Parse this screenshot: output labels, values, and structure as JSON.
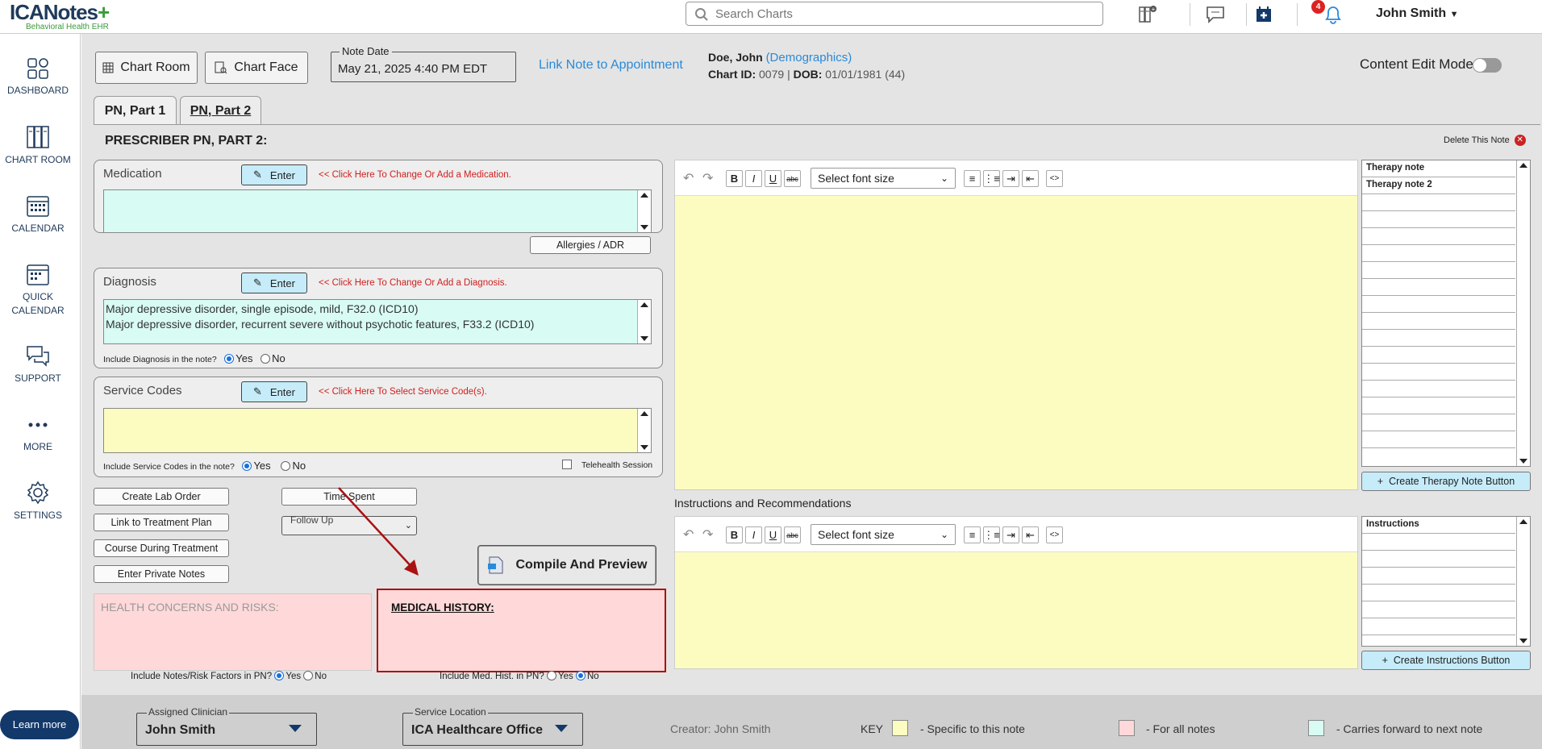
{
  "app": {
    "logo_main": "ICANotes",
    "logo_sub": "Behavioral Health EHR",
    "search_placeholder": "Search Charts",
    "notification_count": "4",
    "user_name": "John Smith"
  },
  "sidebar": {
    "items": [
      {
        "label": "DASHBOARD",
        "icon": "dashboard-icon"
      },
      {
        "label": "CHART ROOM",
        "icon": "chart-room-icon"
      },
      {
        "label": "CALENDAR",
        "icon": "calendar-icon"
      },
      {
        "label": "QUICK CALENDAR",
        "icon": "quick-calendar-icon"
      },
      {
        "label": "SUPPORT",
        "icon": "support-icon"
      },
      {
        "label": "MORE",
        "icon": "more-icon"
      },
      {
        "label": "SETTINGS",
        "icon": "gear-icon"
      }
    ],
    "learn_more": "Learn more"
  },
  "header": {
    "chart_room_btn": "Chart Room",
    "chart_face_btn": "Chart Face",
    "note_date_label": "Note Date",
    "note_date_value": "May 21, 2025 4:40 PM EDT",
    "link_note": "Link Note to Appointment",
    "patient_name": "Doe, John",
    "demographics_link": "(Demographics)",
    "chart_id_label": "Chart ID:",
    "chart_id": "0079",
    "dob_label": "DOB:",
    "dob": "01/01/1981 (44)",
    "content_edit_mode": "Content Edit Mode",
    "content_edit_on": false
  },
  "tabs": [
    {
      "label": "PN, Part 1",
      "active": false
    },
    {
      "label": "PN, Part 2",
      "active": true
    }
  ],
  "page": {
    "title": "PRESCRIBER PN, PART 2:",
    "delete_note": "Delete This Note"
  },
  "medication": {
    "label": "Medication",
    "enter": "Enter",
    "hint": "<< Click Here To Change Or Add a Medication.",
    "allergies_btn": "Allergies / ADR"
  },
  "diagnosis": {
    "label": "Diagnosis",
    "enter": "Enter",
    "hint": "<< Click Here To Change Or Add a Diagnosis.",
    "lines": [
      "Major depressive disorder, single episode, mild, F32.0 (ICD10)",
      "Major depressive disorder, recurrent severe without psychotic features, F33.2 (ICD10)"
    ],
    "include_label": "Include Diagnosis in the note?",
    "yes": "Yes",
    "no": "No",
    "include": "Yes"
  },
  "service_codes": {
    "label": "Service Codes",
    "enter": "Enter",
    "hint": "<< Click Here To Select Service Code(s).",
    "include_label": "Include Service Codes in the note?",
    "yes": "Yes",
    "no": "No",
    "include": "Yes",
    "telehealth": "Telehealth Session",
    "telehealth_checked": false
  },
  "actions": {
    "create_lab_order": "Create Lab Order",
    "link_treatment_plan": "Link to Treatment Plan",
    "course_during_treatment": "Course During Treatment",
    "enter_private_notes": "Enter Private Notes",
    "time_spent": "Time Spent",
    "follow_up": "Follow Up",
    "compile_preview": "Compile And Preview"
  },
  "health": {
    "placeholder": "HEALTH CONCERNS AND RISKS:",
    "include_label": "Include Notes/Risk Factors in PN?",
    "yes": "Yes",
    "no": "No",
    "include": "Yes"
  },
  "medical_history": {
    "title": "MEDICAL HISTORY:",
    "include_label": "Include Med. Hist. in PN?",
    "yes": "Yes",
    "no": "No",
    "include": "No"
  },
  "editor": {
    "font_size_placeholder": "Select font size",
    "bold": "B",
    "italic": "I",
    "underline": "U",
    "strike": "abc"
  },
  "therapy_notes": {
    "items": [
      "Therapy note",
      "Therapy note 2"
    ],
    "create_btn": "Create Therapy Note Button"
  },
  "instructions": {
    "section_label": "Instructions and Recommendations",
    "items": [
      "Instructions"
    ],
    "create_btn": "Create Instructions Button"
  },
  "footer": {
    "assigned_clinician_label": "Assigned Clinician",
    "assigned_clinician": "John Smith",
    "service_location_label": "Service Location",
    "service_location": "ICA Healthcare Office",
    "creator": "Creator: John Smith",
    "key_label": "KEY",
    "key_items": [
      {
        "label": "- Specific to this note",
        "color": "#fcfcc0"
      },
      {
        "label": "- For all notes",
        "color": "#ffd9d9"
      },
      {
        "label": "- Carries forward to next note",
        "color": "#d8fbf4"
      }
    ]
  },
  "colors": {
    "accent_blue": "#2a8ad8",
    "navy": "#13386a",
    "hint_red": "#d02020",
    "yellow_field": "#fcfcc0",
    "pink_field": "#ffd9d9",
    "cyan_field": "#d8fbf4",
    "enter_btn": "#c6ecfa"
  }
}
